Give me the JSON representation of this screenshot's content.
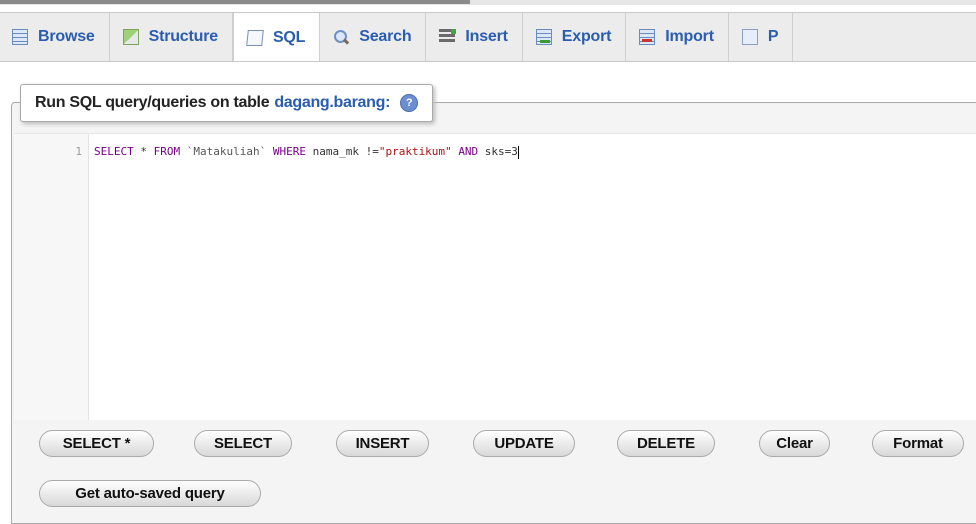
{
  "tabs": [
    {
      "label": "Browse",
      "icon": "browse-icon"
    },
    {
      "label": "Structure",
      "icon": "structure-icon"
    },
    {
      "label": "SQL",
      "icon": "sql-icon",
      "active": true
    },
    {
      "label": "Search",
      "icon": "search-icon"
    },
    {
      "label": "Insert",
      "icon": "insert-icon"
    },
    {
      "label": "Export",
      "icon": "export-icon"
    },
    {
      "label": "Import",
      "icon": "import-icon"
    },
    {
      "label": "P",
      "icon": "privileges-icon"
    }
  ],
  "query_panel": {
    "title_prefix": "Run SQL query/queries on table",
    "table_name": "dagang.barang:",
    "help_icon": "help-icon"
  },
  "editor": {
    "line_number": "1",
    "tokens": {
      "t1": "SELECT",
      "t2": " * ",
      "t3": "FROM",
      "t4": " `Matakuliah` ",
      "t5": "WHERE",
      "t6": " nama_mk !=",
      "t7": "\"praktikum\"",
      "t8": " ",
      "t9": "AND",
      "t10": " sks=3"
    }
  },
  "buttons": {
    "select_star": "SELECT *",
    "select": "SELECT",
    "insert": "INSERT",
    "update": "UPDATE",
    "delete": "DELETE",
    "clear": "Clear",
    "format": "Format",
    "get_autosaved": "Get auto-saved query"
  },
  "colors": {
    "link_blue": "#2a5db0",
    "keyword": "#770088",
    "string": "#aa1111"
  }
}
